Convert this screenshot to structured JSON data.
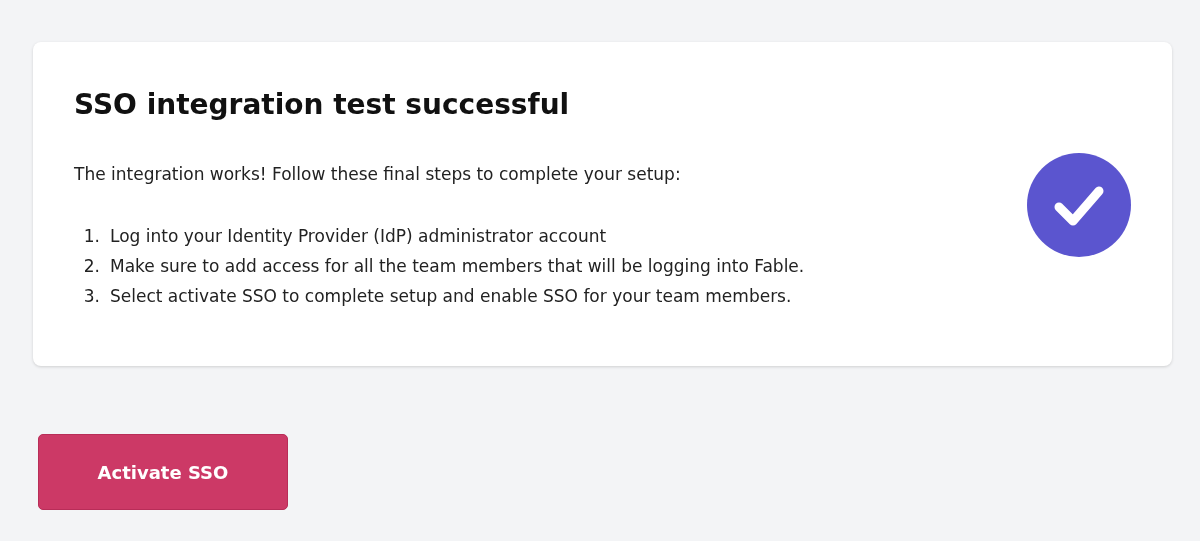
{
  "card": {
    "title": "SSO integration test successful",
    "intro": "The integration works! Follow these final steps to complete your setup:",
    "steps": [
      {
        "number": "1.",
        "text": "Log into your Identity Provider (IdP) administrator account"
      },
      {
        "number": "2.",
        "text": "Make sure to add access for all the team members that will be logging into Fable."
      },
      {
        "number": "3.",
        "text": "Select activate SSO to complete setup and enable SSO for your team members."
      }
    ]
  },
  "button": {
    "label": "Activate SSO"
  }
}
